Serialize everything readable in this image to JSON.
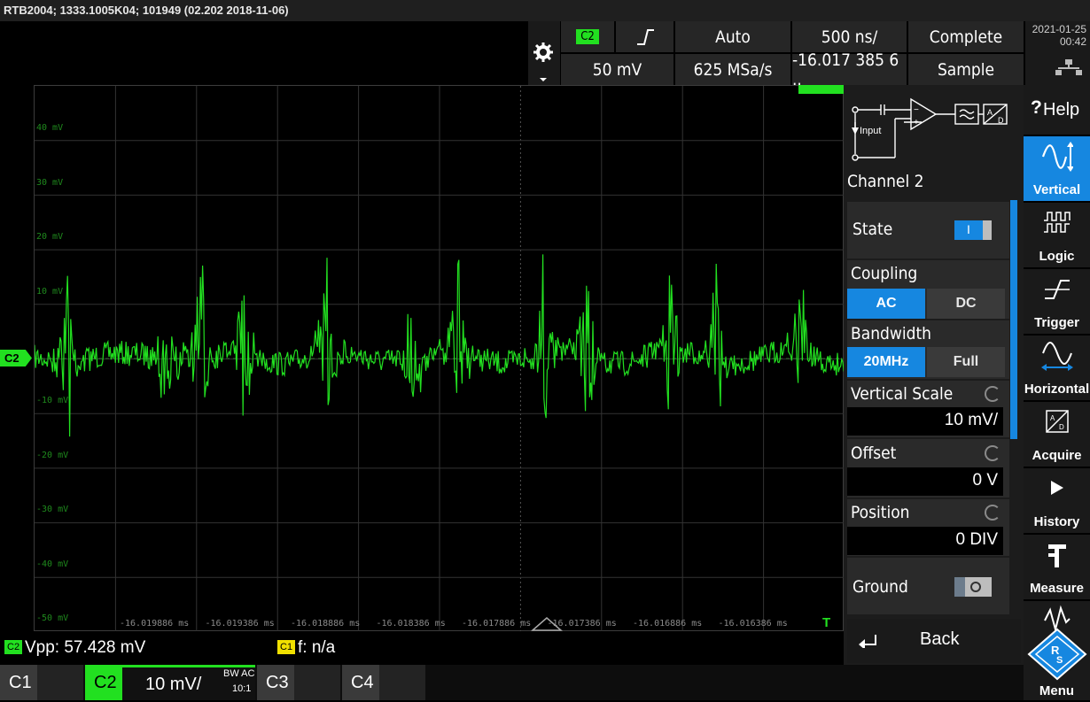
{
  "titlebar": {
    "text": "RTB2004; 1333.1005K04; 101949 (02.202 2018-11-06)"
  },
  "header": {
    "channel_badge": "C2",
    "trigger_mode": "Auto",
    "timebase": "500 ns/",
    "acq_state": "Complete",
    "trigger_level": "50 mV",
    "sample_rate": "625 MSa/s",
    "position": "-16.017 385 6 ..",
    "acq_mode": "Sample",
    "date": "2021-01-25",
    "time": "00:42"
  },
  "waveform": {
    "color": "#22e020",
    "channel_marker": "C2",
    "trigger_marker": "T",
    "y_labels": [
      "40 mV",
      "30 mV",
      "20 mV",
      "10 mV",
      "-10 mV",
      "-20 mV",
      "-30 mV",
      "-40 mV",
      "-50 mV"
    ],
    "x_labels": [
      "-16.019886 ms",
      "-16.019386 ms",
      "-16.018886 ms",
      "-16.018386 ms",
      "-16.017886 ms",
      "-16.017386 ms",
      "-16.016886 ms",
      "-16.016386 ms"
    ]
  },
  "sidepanel": {
    "diagram_input": "Input",
    "channel_title": "Channel 2",
    "state_label": "State",
    "state_toggle": "I",
    "coupling_label": "Coupling",
    "coupling_ac": "AC",
    "coupling_dc": "DC",
    "bandwidth_label": "Bandwidth",
    "bw_20": "20MHz",
    "bw_full": "Full",
    "vscale_label": "Vertical Scale",
    "vscale_value": "10 mV/",
    "offset_label": "Offset",
    "offset_value": "0 V",
    "position_label": "Position",
    "position_value": "0 DIV",
    "ground_label": "Ground",
    "back_label": "Back"
  },
  "rightmenu": {
    "help": "Help",
    "items": [
      "Vertical",
      "Logic",
      "Trigger",
      "Horizontal",
      "Acquire",
      "History",
      "Measure"
    ],
    "menu": "Menu"
  },
  "measurements": {
    "m1_badge": "C2",
    "m1_text": "Vpp: 57.428 mV",
    "m2_badge": "C1",
    "m2_text": "f: n/a"
  },
  "channels": {
    "c1": "C1",
    "c2": "C2",
    "c2_scale": "10 mV/",
    "c2_bw": "BW AC",
    "c2_probe": "10:1",
    "c3": "C3",
    "c4": "C4"
  },
  "colors": {
    "accent_blue": "#1687e0",
    "channel2_green": "#22e020",
    "channel1_yellow": "#f0e000"
  }
}
